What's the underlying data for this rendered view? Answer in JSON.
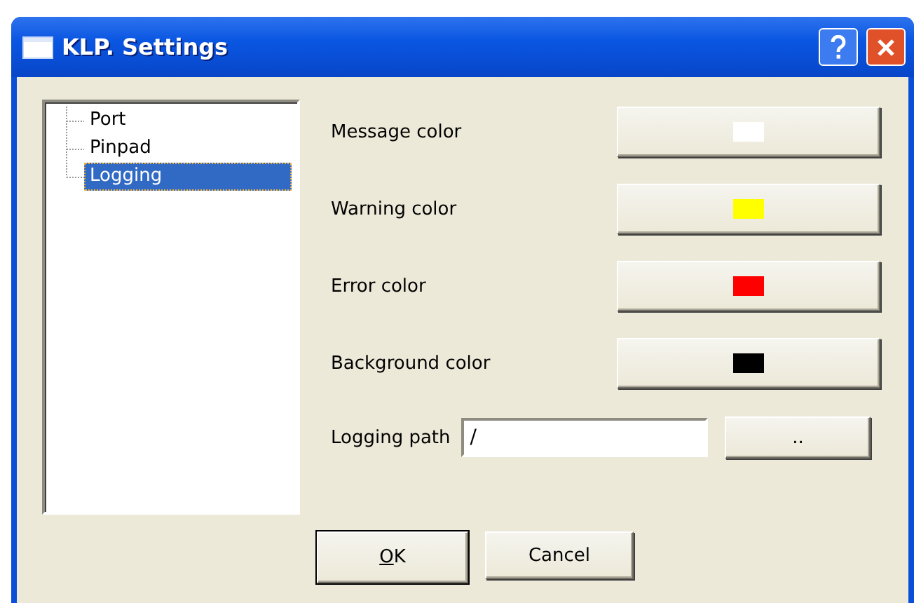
{
  "window": {
    "title": "KLP. Settings"
  },
  "tree": {
    "items": [
      {
        "label": "Port",
        "selected": false
      },
      {
        "label": "Pinpad",
        "selected": false
      },
      {
        "label": "Logging",
        "selected": true
      }
    ]
  },
  "colors": [
    {
      "label": "Message color",
      "color": "#ffffff"
    },
    {
      "label": "Warning color",
      "color": "#ffff00"
    },
    {
      "label": "Error color",
      "color": "#ff0000"
    },
    {
      "label": "Background color",
      "color": "#000000"
    }
  ],
  "path": {
    "label": "Logging path",
    "value": "/",
    "browse": ".."
  },
  "buttons": [
    {
      "label": "OK",
      "default": true
    },
    {
      "label": "Cancel",
      "default": false
    }
  ]
}
